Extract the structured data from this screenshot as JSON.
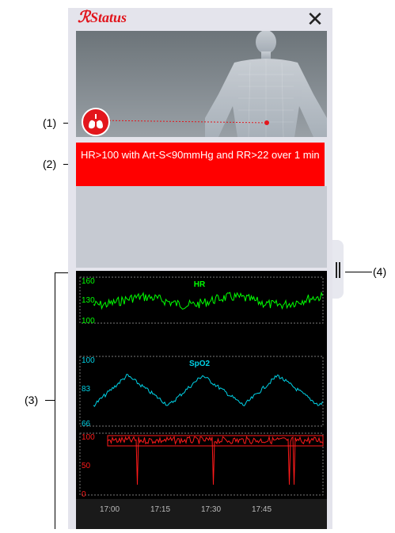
{
  "app": {
    "title": "Status"
  },
  "alert": {
    "message": "HR>100 with Art-S<90mmHg and RR>22 over 1 min"
  },
  "callouts": {
    "c1": "(1)",
    "c2": "(2)",
    "c3": "(3)",
    "c4": "(4)"
  },
  "trends": {
    "hr": {
      "label": "HR",
      "max": "160",
      "mid": "130",
      "min": "100",
      "color": "#00ff00"
    },
    "spo2": {
      "label": "SpO2",
      "max": "100",
      "mid": "83",
      "min": "66",
      "color": "#00d2e6"
    },
    "third": {
      "max": "100",
      "mid": "50",
      "min": "0",
      "color": "#ff1a1a"
    },
    "time_labels": [
      "17:00",
      "17:15",
      "17:30",
      "17:45"
    ]
  },
  "colors": {
    "brand": "#e1141b",
    "alert_bg": "#ff0000"
  }
}
